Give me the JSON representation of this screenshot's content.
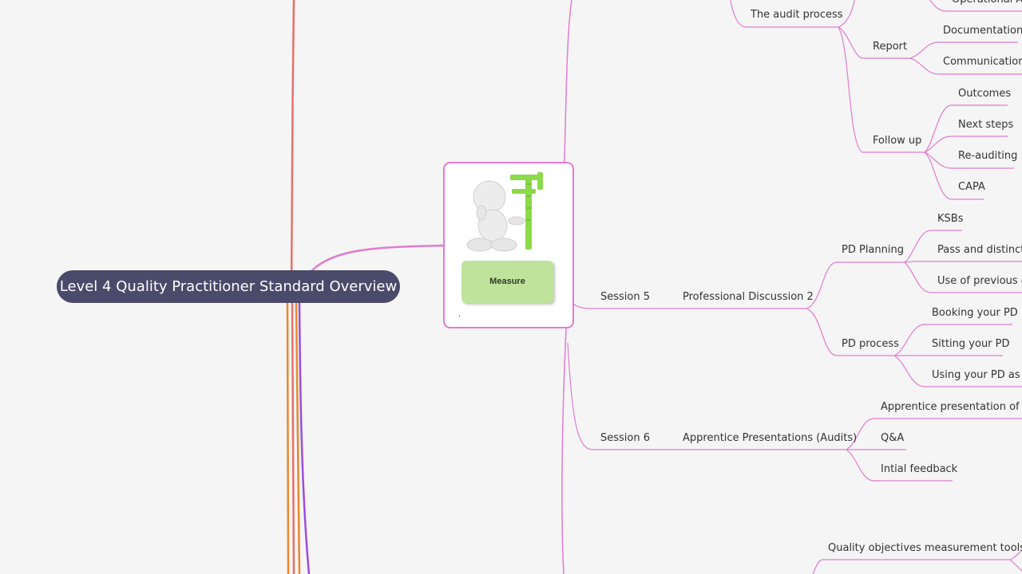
{
  "root": {
    "title": "Level 4 Quality Practitioner Standard Overview"
  },
  "card": {
    "button_label": "Measure",
    "note": ".",
    "image": "thinking-figure-with-caliper"
  },
  "nodes": {
    "operational": "Operational Ac",
    "audit_process": "The audit process",
    "report": "Report",
    "documentation": "Documentation",
    "communication": "Communication",
    "follow_up": "Follow up",
    "outcomes": "Outcomes",
    "next_steps": "Next steps",
    "re_auditing": "Re-auditing",
    "capa": "CAPA",
    "session5": "Session 5",
    "pd2": "Professional Discussion 2",
    "pd_planning": "PD Planning",
    "ksbs": "KSBs",
    "pass_distinction": "Pass and distinctio",
    "use_previous": "Use of previous ev",
    "pd_process": "PD process",
    "booking": "Booking your PD",
    "sitting": "Sitting your PD",
    "using": "Using your PD as ev",
    "session6": "Session 6",
    "apprentice_presentations": "Apprentice Presentations (Audits)",
    "apprentice_presentation_of": "Apprentice presentation of Au",
    "qa": "Q&A",
    "initial_feedback": "Intial feedback",
    "quality_objectives": "Quality objectives measurement tools"
  },
  "colors": {
    "branch_pink": "#e07ccf",
    "branch_red": "#e8706a",
    "branch_orange": "#e8892f",
    "branch_purple": "#9b4de0",
    "root_bg": "#4a4a6a",
    "button_green": "#bfe39a"
  }
}
